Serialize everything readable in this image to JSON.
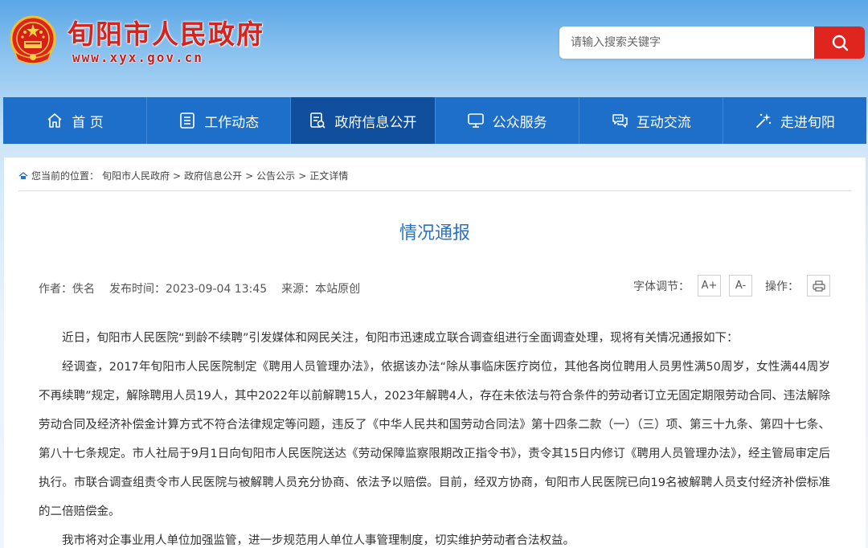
{
  "header": {
    "site_title": "旬阳市人民政府",
    "site_url": "www.xyx.gov.cn",
    "search_placeholder": "请输入搜索关键字"
  },
  "nav": {
    "items": [
      {
        "label": "首 页",
        "icon": "home-icon"
      },
      {
        "label": "工作动态",
        "icon": "document-list-icon"
      },
      {
        "label": "政府信息公开",
        "icon": "document-search-icon"
      },
      {
        "label": "公众服务",
        "icon": "monitor-icon"
      },
      {
        "label": "互动交流",
        "icon": "chat-icon"
      },
      {
        "label": "走进旬阳",
        "icon": "sparkle-icon"
      }
    ],
    "active_index": 2
  },
  "breadcrumb": {
    "prefix": "您当前的位置：",
    "items": [
      "旬阳市人民政府",
      "政府信息公开",
      "公告公示",
      "正文详情"
    ],
    "separator": ">"
  },
  "article": {
    "title": "情况通报",
    "author": "作者：佚名",
    "publish_time": "发布时间：2023-09-04 13:45",
    "source": "来源：本站原创",
    "font_label": "字体调节：",
    "font_increase": "A+",
    "font_decrease": "A-",
    "operation_label": "操作：",
    "paragraphs": [
      "近日，旬阳市人民医院“到龄不续聘”引发媒体和网民关注，旬阳市迅速成立联合调查组进行全面调查处理，现将有关情况通报如下：",
      "经调查，2017年旬阳市人民医院制定《聘用人员管理办法》，依据该办法“除从事临床医疗岗位，其他各岗位聘用人员男性满50周岁，女性满44周岁不再续聘”规定，解除聘用人员19人，其中2022年以前解聘15人，2023年解聘4人，存在未依法与符合条件的劳动者订立无固定期限劳动合同、违法解除劳动合同及经济补偿金计算方式不符合法律规定等问题，违反了《中华人民共和国劳动合同法》第十四条二款（一）（三）项、第三十九条、第四十七条、第八十七条规定。市人社局于9月1日向旬阳市人民医院送达《劳动保障监察限期改正指令书》，责令其15日内修订《聘用人员管理办法》，经主管局审定后执行。市联合调查组责令市人民医院与被解聘人员充分协商、依法予以赔偿。目前，经双方协商，旬阳市人民医院已向19名被解聘人员支付经济补偿标准的二倍赔偿金。",
      "我市将对企事业用人单位加强监管，进一步规范用人单位人事管理制度，切实维护劳动者合法权益。"
    ]
  },
  "colors": {
    "brand_red": "#d8221d",
    "nav_blue": "#1d6fca",
    "nav_active": "#0f4f9e",
    "title_blue": "#2773c9"
  }
}
